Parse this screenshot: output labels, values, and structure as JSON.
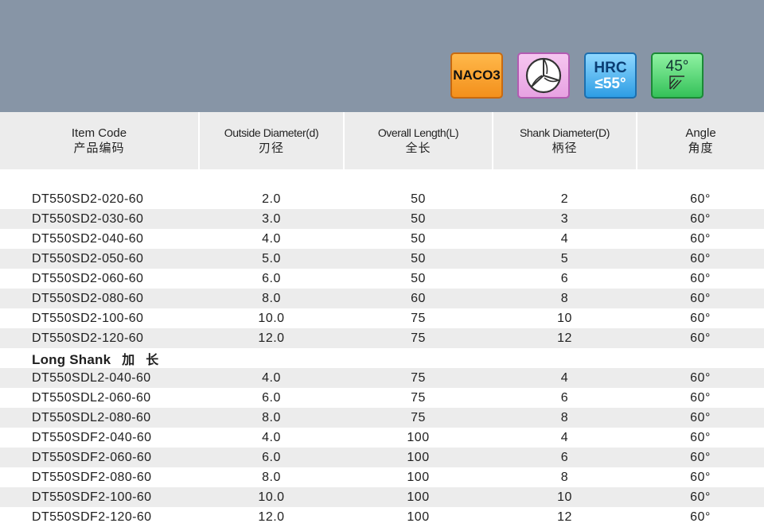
{
  "badges": {
    "coating": "NACO3",
    "hrc_top": "HRC",
    "hrc_bottom": "≤55°",
    "angle": "45°"
  },
  "colors": {
    "banner": "#8795a6",
    "row_alt": "#ececec",
    "naco": "#f3901c",
    "flute": "#e7a2e2",
    "hrc": "#2e9de4",
    "angle": "#34c159"
  },
  "headers": [
    {
      "en": "Item Code",
      "cn": "产品编码"
    },
    {
      "en": "Outside Diameter(d)",
      "cn": "刃径"
    },
    {
      "en": "Overall Length(L)",
      "cn": "全长"
    },
    {
      "en": "Shank Diameter(D)",
      "cn": "柄径"
    },
    {
      "en": "Angle",
      "cn": "角度"
    }
  ],
  "rows": [
    [
      "DT550SD2-020-60",
      "2.0",
      "50",
      "2",
      "60°"
    ],
    [
      "DT550SD2-030-60",
      "3.0",
      "50",
      "3",
      "60°"
    ],
    [
      "DT550SD2-040-60",
      "4.0",
      "50",
      "4",
      "60°"
    ],
    [
      "DT550SD2-050-60",
      "5.0",
      "50",
      "5",
      "60°"
    ],
    [
      "DT550SD2-060-60",
      "6.0",
      "50",
      "6",
      "60°"
    ],
    [
      "DT550SD2-080-60",
      "8.0",
      "60",
      "8",
      "60°"
    ],
    [
      "DT550SD2-100-60",
      "10.0",
      "75",
      "10",
      "60°"
    ],
    [
      "DT550SD2-120-60",
      "12.0",
      "75",
      "12",
      "60°"
    ]
  ],
  "section": {
    "en": "Long Shank",
    "cn": "加长"
  },
  "rows_long": [
    [
      "DT550SDL2-040-60",
      "4.0",
      "75",
      "4",
      "60°"
    ],
    [
      "DT550SDL2-060-60",
      "6.0",
      "75",
      "6",
      "60°"
    ],
    [
      "DT550SDL2-080-60",
      "8.0",
      "75",
      "8",
      "60°"
    ],
    [
      "DT550SDF2-040-60",
      "4.0",
      "100",
      "4",
      "60°"
    ],
    [
      "DT550SDF2-060-60",
      "6.0",
      "100",
      "6",
      "60°"
    ],
    [
      "DT550SDF2-080-60",
      "8.0",
      "100",
      "8",
      "60°"
    ],
    [
      "DT550SDF2-100-60",
      "10.0",
      "100",
      "10",
      "60°"
    ],
    [
      "DT550SDF2-120-60",
      "12.0",
      "100",
      "12",
      "60°"
    ]
  ]
}
